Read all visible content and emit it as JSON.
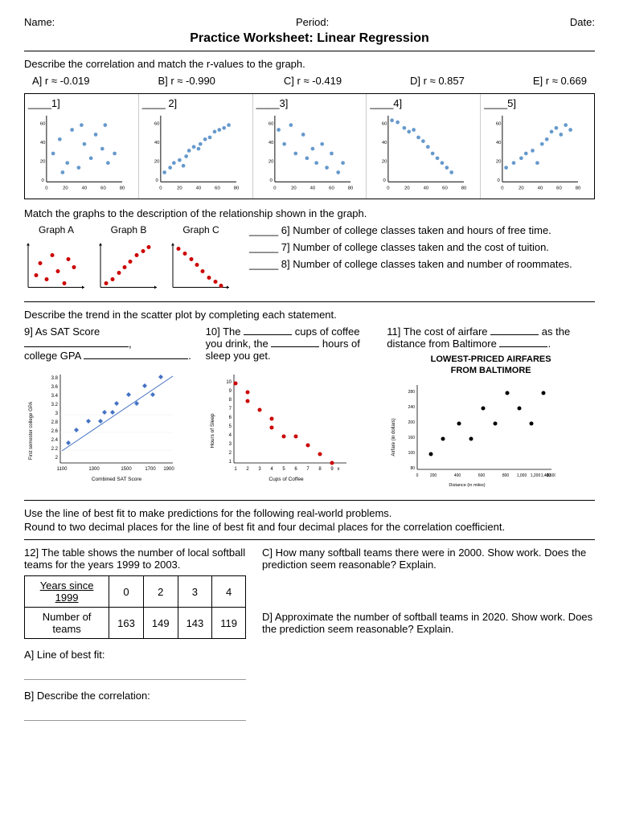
{
  "header": {
    "name_label": "Name:",
    "period_label": "Period:",
    "date_label": "Date:",
    "title": "Practice Worksheet: Linear Regression"
  },
  "section1": {
    "instruction": "Describe the correlation and match the r-values to the graph.",
    "rvalues": [
      {
        "letter": "A]",
        "value": "r ≈ -0.019"
      },
      {
        "letter": "B]",
        "value": "r ≈ -0.990"
      },
      {
        "letter": "C]",
        "value": "r ≈ -0.419"
      },
      {
        "letter": "D]",
        "value": "r ≈ 0.857"
      },
      {
        "letter": "E]",
        "value": "r ≈ 0.669"
      }
    ],
    "graphs": [
      {
        "label": "____1]"
      },
      {
        "label": "____ 2]"
      },
      {
        "label": "____3]"
      },
      {
        "label": "____4]"
      },
      {
        "label": "____5]"
      }
    ]
  },
  "section2": {
    "instruction": "Match the graphs to the description of the relationship shown in the graph.",
    "graph_labels": [
      "Graph A",
      "Graph B",
      "Graph C"
    ],
    "descriptions": [
      {
        "num": "6]",
        "text": "Number of college classes taken and hours of free time."
      },
      {
        "num": "7]",
        "text": "Number of college classes taken and the cost of tuition."
      },
      {
        "num": "8]",
        "text": "Number of college classes taken and number of roommates."
      }
    ]
  },
  "section3": {
    "instruction": "Describe the trend in the scatter plot by completing each statement.",
    "q9": {
      "prefix": "9]  As SAT Score",
      "mid": ", college GPA",
      "end": "."
    },
    "q10": {
      "prefix": "10]  The",
      "mid1": "cups of coffee you drink, the",
      "mid2": "hours of sleep you get."
    },
    "q11": {
      "prefix": "11]  The cost of airfare",
      "mid": "as the distance from Baltimore",
      "end": "."
    },
    "chart11_title1": "LOWEST-PRICED AIRFARES",
    "chart11_title2": "FROM BALTIMORE"
  },
  "section4": {
    "instruction1": "Use the line of best fit to make predictions for the following real-world problems.",
    "instruction2": "Round to two decimal places for the line of best fit and four decimal places for the correlation coefficient.",
    "q12_desc": "12]  The table shows the number of local softball teams for the years 1999 to 2003.",
    "table": {
      "headers": [
        "Years since 1999",
        "0",
        "2",
        "3",
        "4"
      ],
      "row": [
        "Number of teams",
        "163",
        "149",
        "143",
        "119"
      ]
    },
    "qC": "C]  How many softball teams there were in 2000.  Show work. Does the prediction seem reasonable?  Explain.",
    "qD": "D]  Approximate the number of softball teams in 2020.  Show work. Does the prediction seem reasonable?  Explain.",
    "qA_label": "A]  Line of best fit:",
    "qB_label": "B]  Describe the correlation:"
  }
}
